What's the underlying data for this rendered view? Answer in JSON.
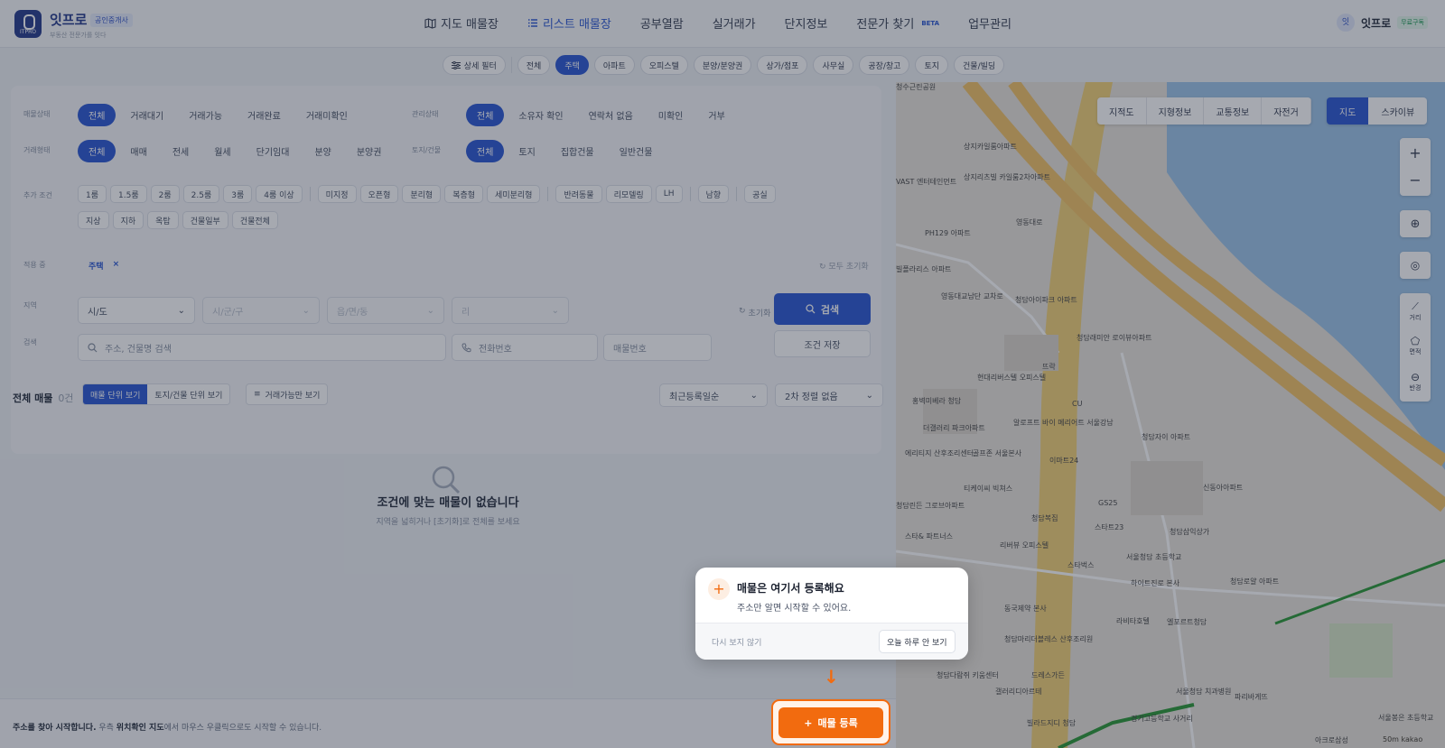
{
  "header": {
    "brand": "잇프로",
    "brand_badge": "공인중개사",
    "slogan": "부동산 전문가를 잇다",
    "logo_text": "ITPRO",
    "nav": [
      {
        "label": "지도 매물장",
        "icon": "map-icon"
      },
      {
        "label": "리스트 매물장",
        "icon": "list-icon",
        "active": true
      },
      {
        "label": "공부열람"
      },
      {
        "label": "실거래가"
      },
      {
        "label": "단지정보"
      },
      {
        "label": "전문가 찾기",
        "badge": "BETA"
      },
      {
        "label": "업무관리"
      }
    ],
    "user": {
      "avatar": "잇",
      "name": "잇프로",
      "plan": "무료구독"
    }
  },
  "categories": {
    "detail_filter": "상세 필터",
    "items": [
      "전체",
      "주택",
      "아파트",
      "오피스텔",
      "분양/분양권",
      "상가/점포",
      "사무실",
      "공장/창고",
      "토지",
      "건물/빌딩"
    ],
    "selected": "주택"
  },
  "filters": {
    "status_label": "매물상태",
    "status": [
      "전체",
      "거래대기",
      "거래가능",
      "거래완료",
      "거래미확인"
    ],
    "manage_label": "관리상태",
    "manage": [
      "전체",
      "소유자 확인",
      "연락처 없음",
      "미확인",
      "거부"
    ],
    "deal_label": "거래형태",
    "deal": [
      "전체",
      "매매",
      "전세",
      "월세",
      "단기임대",
      "분양",
      "분양권"
    ],
    "land_label": "토지/건물",
    "land": [
      "전체",
      "토지",
      "집합건물",
      "일반건물"
    ],
    "extra_label": "추가 조건",
    "extra_row1": [
      [
        "1룸",
        "1.5룸",
        "2룸",
        "2.5룸",
        "3룸",
        "4룸 이상"
      ],
      [
        "미지정",
        "오픈형",
        "분리형",
        "복층형",
        "세미분리형"
      ],
      [
        "반려동물",
        "리모델링",
        "LH"
      ],
      [
        "남향"
      ],
      [
        "공실"
      ]
    ],
    "extra_row2": [
      "지상",
      "지하",
      "옥탑",
      "건물일부",
      "건물전체"
    ],
    "applied_label": "적용 중",
    "applied": "주택",
    "reset_all": "모두 초기화",
    "region_label": "지역",
    "region": [
      "시/도",
      "시/군/구",
      "읍/면/동",
      "리"
    ],
    "reset": "초기화",
    "search_btn": "검색",
    "search_label": "검색",
    "address_placeholder": "주소, 건물명 검색",
    "phone_placeholder": "전화번호",
    "number_placeholder": "매물번호",
    "save_btn": "조건 저장"
  },
  "list": {
    "title": "전체 매물",
    "count": "0건",
    "view_unit": "매물 단위 보기",
    "view_land": "토지/건물 단위 보기",
    "available_only": "거래가능만 보기",
    "sort1": "최근등록일순",
    "sort2": "2차 정렬 없음",
    "empty_title": "조건에 맞는 매물이 없습니다",
    "empty_sub": "지역을 넓히거나 [초기화]로 전체를 보세요"
  },
  "footer": {
    "hint_bold": "주소를 찾아 시작합니다.",
    "hint_mid": " 우측 ",
    "hint_bold2": "위치확인 지도",
    "hint_end": "에서 마우스 우클릭으로도 시작할 수 있습니다."
  },
  "map": {
    "layers": [
      "지적도",
      "지형정보",
      "교통정보",
      "자전거"
    ],
    "types": [
      "지도",
      "스카이뷰"
    ],
    "tools": {
      "zoom_in": "+",
      "zoom_out": "−",
      "distance": "거리",
      "area": "면적",
      "radius": "반경"
    },
    "labels": [
      "상지카일룸아파트",
      "VAST 엔터테인먼트",
      "상지리츠빌 카일룸2차아파트",
      "PH129 아파트",
      "빌폴라리스 아파트",
      "영동대로",
      "청담아이파크 아파트",
      "청담래미안 로이뷰아파트",
      "영동대교남단 교차로",
      "현대리버스텔 오피스텔",
      "홍벽미베라 청담",
      "더갤러리 파크아파트",
      "알로프트 바이 메리어트 서울강남",
      "청담자이 아파트",
      "에리티지 산후조리센터",
      "골프존 서울본사",
      "이마트24",
      "티케이씨 빅쳐스",
      "청담린든 그로브아파트",
      "청담복집",
      "GS25",
      "스타트23",
      "신동아아파트",
      "청수근린공원",
      "스타& 파트너스",
      "리버뷰 오피스텔",
      "스타벅스",
      "청담삼익상가",
      "서울청담 초등학교",
      "하이트진로 본사",
      "동국제약 본사",
      "청담로얄 아파트",
      "라비타호텔",
      "엘포르트청담",
      "청담마리더블레스 산후조리원",
      "드레스가든",
      "갤러리디아르테",
      "빌라드지디 청담",
      "경기고등학교 사거리",
      "청담다람쥐 키움센터",
      "서울청담 치과병원",
      "파리바게뜨",
      "아크로삼성",
      "서울봉은 초등학교",
      "CU",
      "뜨락"
    ],
    "scale": "50m",
    "attribution": "kakao"
  },
  "popup": {
    "icon": "+",
    "title": "매물은 여기서 등록해요",
    "sub": "주소만 알면 시작할 수 있어요.",
    "dont_show": "다시 보지 않기",
    "today_hide": "오늘 하루 안 보기"
  },
  "register_btn": "매물 등록"
}
